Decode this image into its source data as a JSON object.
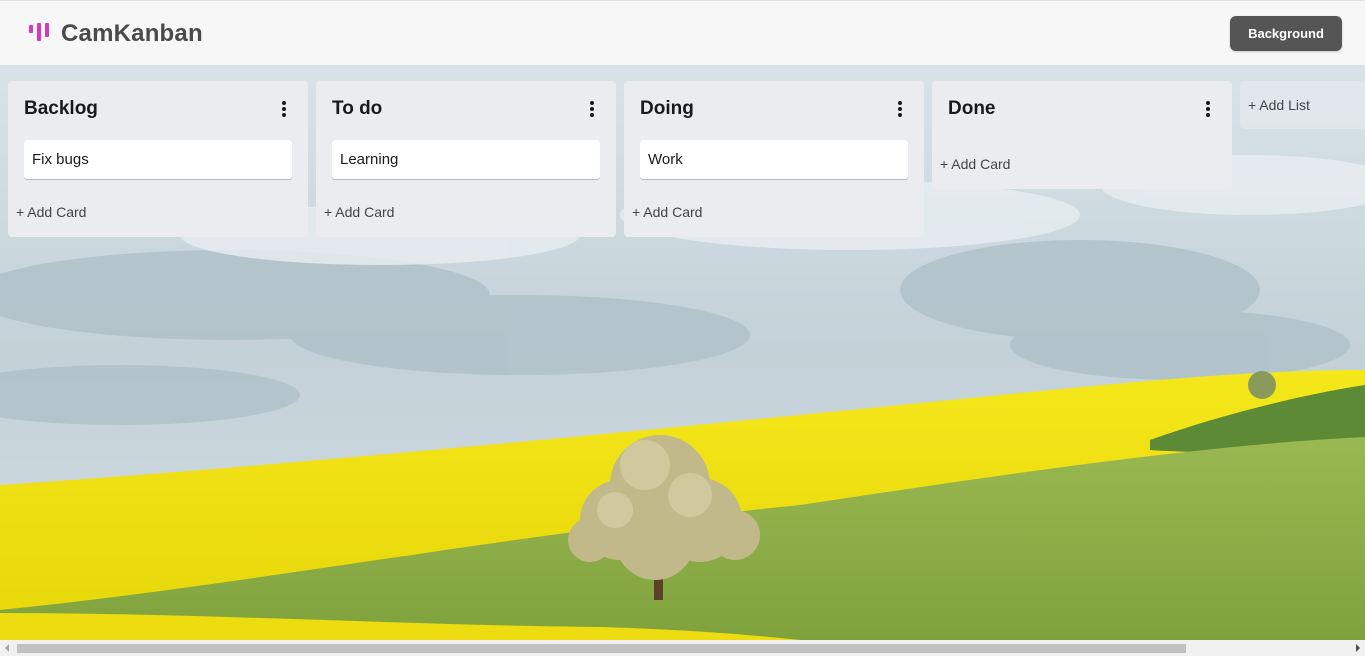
{
  "header": {
    "brand": "CamKanban",
    "background_button": "Background",
    "logo_color": "#d63ab8"
  },
  "lists": [
    {
      "title": "Backlog",
      "cards": [
        "Fix bugs"
      ],
      "add_card_label": "+ Add Card"
    },
    {
      "title": "To do",
      "cards": [
        "Learning"
      ],
      "add_card_label": "+ Add Card"
    },
    {
      "title": "Doing",
      "cards": [
        "Work"
      ],
      "add_card_label": "+ Add Card"
    },
    {
      "title": "Done",
      "cards": [],
      "add_card_label": "+ Add Card"
    }
  ],
  "add_list_label": "+ Add List",
  "icons": {
    "logo": "kanban-logo-icon",
    "list_menu": "more-vertical-icon",
    "scroll_left": "arrow-left-icon",
    "scroll_right": "arrow-right-icon"
  },
  "colors": {
    "header_bg": "#f7f7f7",
    "button_bg": "#555555",
    "list_bg": "#ebecf0",
    "field_yellow": "#f2e40c",
    "grass_green": "#8fb04a"
  }
}
